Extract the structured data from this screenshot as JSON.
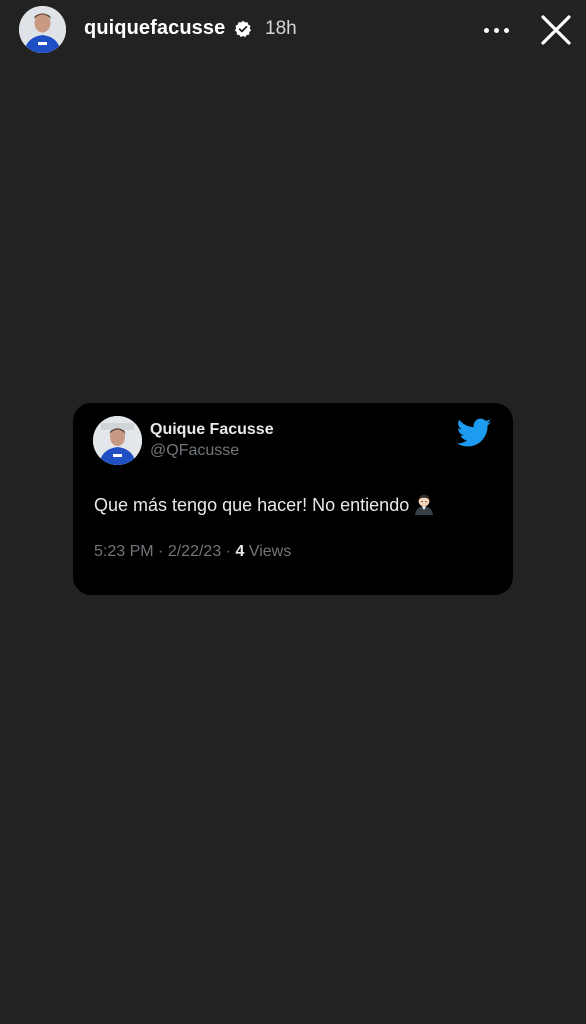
{
  "header": {
    "username": "quiquefacusse",
    "time_ago": "18h",
    "avatar_icon": "profile-photo",
    "verified_icon": "verified-badge-icon",
    "more_icon": "more-dots-icon",
    "close_icon": "close-icon"
  },
  "tweet": {
    "display_name": "Quique Facusse",
    "handle": "@QFacusse",
    "text": "Que más tengo que hacer! No entiendo",
    "emoji_icon": "man-shrugging-emoji",
    "time": "5:23 PM",
    "date": "2/22/23",
    "views_count": "4",
    "views_label": "Views",
    "brand_icon": "twitter-bird-icon",
    "brand_color": "#1d9bf0"
  },
  "colors": {
    "background": "#222222",
    "card": "#000000",
    "muted_text": "#71767b"
  }
}
